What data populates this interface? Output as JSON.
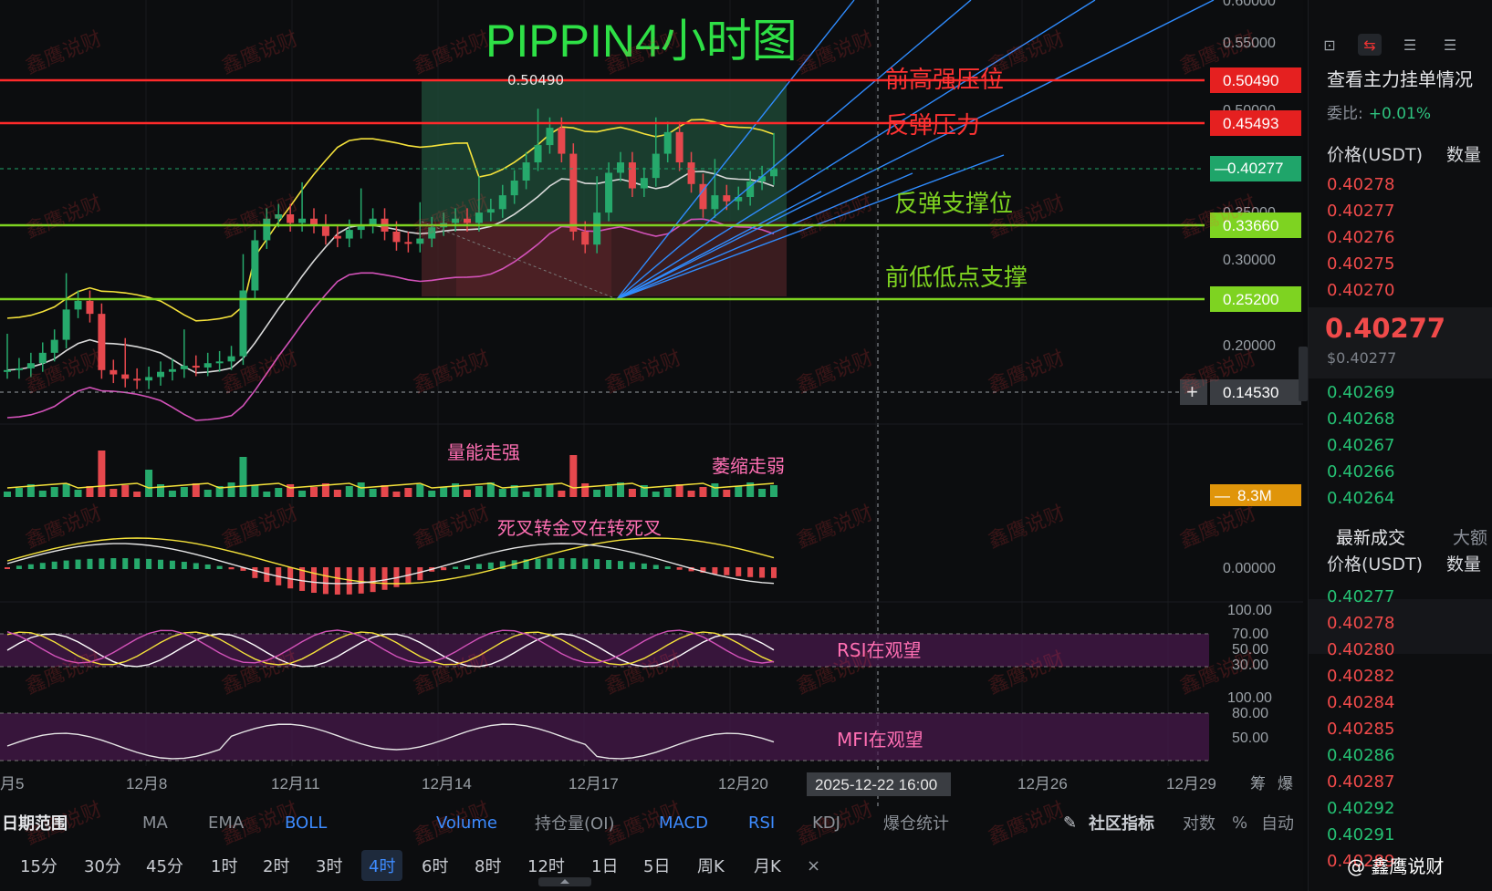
{
  "chart_title": "PIPPIN4小时图",
  "cursor_price_label": "0.50490",
  "annotations": {
    "resistance_high": "前高强压位",
    "rebound_resistance": "反弹压力",
    "rebound_support": "反弹支撑位",
    "prev_low_support": "前低低点支撑",
    "volume_strong": "量能走强",
    "volume_weak": "萎缩走弱",
    "macd_note": "死叉转金叉在转死叉",
    "rsi_note": "RSI在观望",
    "mfi_note": "MFI在观望"
  },
  "price_tags": {
    "high": "0.50490",
    "rebound": "0.45493",
    "current": "0.40277",
    "support": "0.33660",
    "low": "0.25200",
    "crosshair": "0.14530",
    "volume": "8.3M"
  },
  "colors": {
    "up": "#26a96c",
    "down": "#e5484d",
    "resistance_line": "#ff2a2a",
    "support_line": "#7ed321",
    "current_tag": "#1fa56a",
    "boll_upper": "#f5e23b",
    "boll_mid": "#d9d9d9",
    "boll_lower": "#d352b9",
    "fan": "#2f8cff",
    "title": "#2ee046"
  },
  "axis": {
    "price_ticks": [
      "0.60000",
      "0.55000",
      "0.50000",
      "0.35000",
      "0.30000",
      "0.20000"
    ],
    "macd_tick": "0.00000",
    "rsi_ticks": [
      "100.00",
      "70.00",
      "50.00",
      "30.00"
    ],
    "mfi_ticks": [
      "100.00",
      "80.00",
      "50.00"
    ],
    "dates": [
      "月5",
      "12月8",
      "12月11",
      "12月14",
      "12月17",
      "12月20",
      "12月26",
      "12月29"
    ],
    "crosshair_date": "2025-12-22 16:00",
    "right_labels": [
      "筹",
      "爆"
    ]
  },
  "chart_data": {
    "type": "candlestick",
    "title": "PIPPIN4小时图",
    "y_range": [
      0.12,
      0.6
    ],
    "horizontal_levels": [
      {
        "label": "前高强压位",
        "value": 0.5049
      },
      {
        "label": "反弹压力",
        "value": 0.45493
      },
      {
        "label": "反弹支撑位",
        "value": 0.3366
      },
      {
        "label": "前低低点支撑",
        "value": 0.252
      }
    ],
    "current_price": 0.40277,
    "ohlc_close_series": [
      0.17,
      0.172,
      0.178,
      0.19,
      0.205,
      0.24,
      0.25,
      0.235,
      0.17,
      0.165,
      0.16,
      0.158,
      0.162,
      0.168,
      0.171,
      0.175,
      0.173,
      0.178,
      0.18,
      0.186,
      0.262,
      0.32,
      0.345,
      0.35,
      0.34,
      0.345,
      0.338,
      0.325,
      0.322,
      0.332,
      0.338,
      0.345,
      0.33,
      0.318,
      0.316,
      0.322,
      0.335,
      0.34,
      0.345,
      0.34,
      0.352,
      0.356,
      0.372,
      0.389,
      0.41,
      0.43,
      0.45,
      0.42,
      0.33,
      0.315,
      0.352,
      0.398,
      0.41,
      0.38,
      0.392,
      0.42,
      0.445,
      0.41,
      0.385,
      0.356,
      0.372,
      0.365,
      0.37,
      0.388,
      0.394,
      0.402
    ]
  },
  "indicator_bar": {
    "date_range": "日期范围",
    "items": [
      "MA",
      "EMA",
      "BOLL",
      "Volume",
      "持仓量(OI)",
      "MACD",
      "RSI",
      "KDJ",
      "爆仓统计"
    ],
    "community": "社区指标",
    "log": "对数",
    "pct": "%",
    "auto": "自动"
  },
  "timeframes": [
    "15分",
    "30分",
    "45分",
    "1时",
    "2时",
    "3时",
    "4时",
    "6时",
    "8时",
    "12时",
    "1日",
    "5日",
    "周K",
    "月K"
  ],
  "active_timeframe": "4时",
  "watermark": "鑫鹰说财",
  "footer_logo": "@ 鑫鹰说财",
  "orderbook": {
    "title": "查看主力挂单情况",
    "ratio_label": "委比:",
    "ratio_value": "+0.01%",
    "col_price": "价格(USDT)",
    "col_qty": "数量",
    "asks": [
      "0.40278",
      "0.40277",
      "0.40276",
      "0.40275",
      "0.40270"
    ],
    "last_price": "0.40277",
    "last_price_usd": "$0.40277",
    "bids": [
      "0.40269",
      "0.40268",
      "0.40267",
      "0.40266",
      "0.40264"
    ],
    "trades_title": "最新成交",
    "trades_alt": "大额",
    "trades": [
      {
        "p": "0.40277",
        "c": "green"
      },
      {
        "p": "0.40278",
        "c": "red"
      },
      {
        "p": "0.40280",
        "c": "red"
      },
      {
        "p": "0.40282",
        "c": "red"
      },
      {
        "p": "0.40284",
        "c": "red"
      },
      {
        "p": "0.40285",
        "c": "red"
      },
      {
        "p": "0.40286",
        "c": "green"
      },
      {
        "p": "0.40287",
        "c": "red"
      },
      {
        "p": "0.40292",
        "c": "green"
      },
      {
        "p": "0.40291",
        "c": "green"
      },
      {
        "p": "0.40289",
        "c": "red"
      }
    ]
  }
}
